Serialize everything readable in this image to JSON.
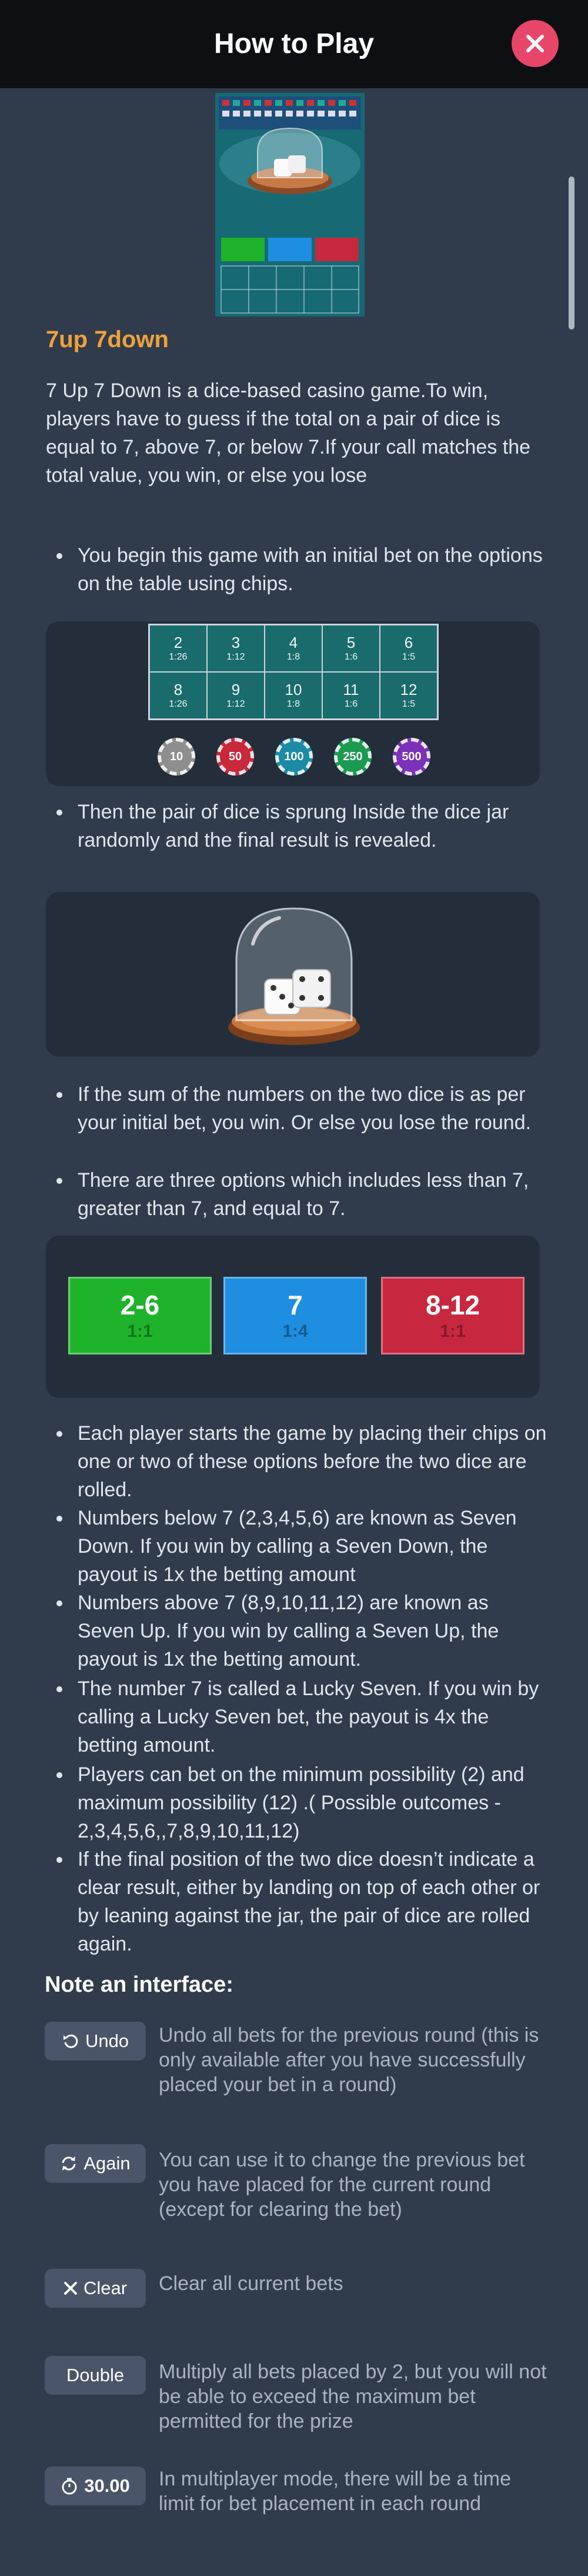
{
  "header": {
    "title": "How to Play"
  },
  "game": {
    "title": "7up 7down",
    "intro": "7 Up 7 Down is a dice-based casino game.To win, players have to guess if the total on a pair of dice is equal to 7, above 7, or below 7.If your call matches the total value, you win, or else you lose"
  },
  "bullets_1": [
    "You begin this game with an initial bet on the options on the table using chips."
  ],
  "board": {
    "cells": [
      {
        "n": "2",
        "p": "1:26"
      },
      {
        "n": "3",
        "p": "1:12"
      },
      {
        "n": "4",
        "p": "1:8"
      },
      {
        "n": "5",
        "p": "1:6"
      },
      {
        "n": "6",
        "p": "1:5"
      },
      {
        "n": "8",
        "p": "1:26"
      },
      {
        "n": "9",
        "p": "1:12"
      },
      {
        "n": "10",
        "p": "1:8"
      },
      {
        "n": "11",
        "p": "1:6"
      },
      {
        "n": "12",
        "p": "1:5"
      }
    ]
  },
  "chips": [
    {
      "label": "10",
      "color": "#8e8e8e"
    },
    {
      "label": "50",
      "color": "#c8283a"
    },
    {
      "label": "100",
      "color": "#1d8aa6"
    },
    {
      "label": "250",
      "color": "#1b9a52"
    },
    {
      "label": "500",
      "color": "#7b32b8"
    }
  ],
  "bullets_2": [
    "Then the pair of dice is sprung Inside the dice jar randomly and the final result is revealed."
  ],
  "bullets_3": [
    "If the sum of the numbers on the two dice is as per your initial bet, you win. Or else you lose the round.",
    "There are three options which includes less than 7, greater than 7, and equal to 7."
  ],
  "options": [
    {
      "big": "2-6",
      "small": "1:1",
      "color": "#1fb32c"
    },
    {
      "big": "7",
      "small": "1:4",
      "color": "#1e8ee0"
    },
    {
      "big": "8-12",
      "small": "1:1",
      "color": "#c8283f"
    }
  ],
  "bullets_4": [
    "Each player starts the game by placing their chips on one or two of these options before the two dice are rolled.",
    "Numbers below 7 (2,3,4,5,6) are known as Seven Down. If you win by calling a Seven Down, the payout is 1x the betting amount",
    "Numbers above 7 (8,9,10,11,12) are known as Seven Up. If you win by calling a Seven Up, the payout is 1x the betting amount.",
    "The number 7 is called a Lucky Seven. If you win by calling a Lucky Seven bet, the payout is 4x the betting amount.",
    "Players can bet on the minimum possibility (2) and maximum possibility (12) .( Possible outcomes - 2,3,4,5,6,,7,8,9,10,11,12)",
    "If the final position of the two dice doesn’t indicate a clear result, either by landing on top of each other or by leaning against the jar, the pair of dice are rolled again."
  ],
  "notes": {
    "title": "Note an interface:",
    "undo_label": "Undo",
    "undo_desc": "Undo all bets for the previous round (this is only available after you have successfully placed your bet in a round)",
    "again_label": "Again",
    "again_desc": "You can use it to change the previous bet you have placed for the current round (except for clearing the bet)",
    "clear_label": "Clear",
    "clear_desc": "Clear all current bets",
    "double_label": "Double",
    "double_desc": "Multiply all bets placed by 2, but you will not be able to exceed the maximum bet permitted for the prize",
    "timer_label": "30.00",
    "timer_desc": "In multiplayer mode, there will be a time limit for bet placement in each round"
  },
  "colors": {
    "accent": "#f0a23a",
    "close": "#e8456a",
    "background": "#303c4c",
    "panel": "#242e3b"
  }
}
